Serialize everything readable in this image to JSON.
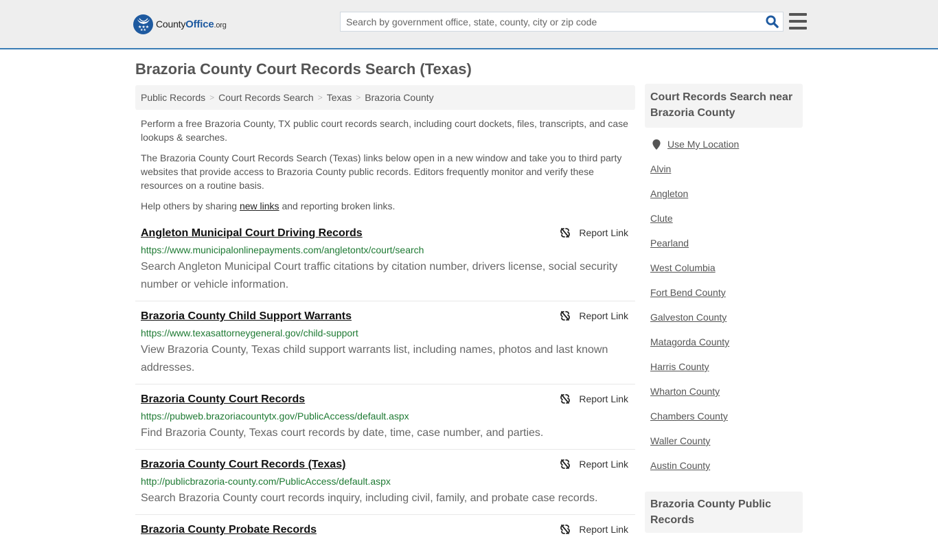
{
  "header": {
    "logo": {
      "name": "County",
      "brand": "Office",
      "suffix": ".org"
    },
    "search": {
      "placeholder": "Search by government office, state, county, city or zip code",
      "value": ""
    },
    "icons": {
      "search": "search-icon",
      "menu": "hamburger-menu-icon"
    }
  },
  "page": {
    "title": "Brazoria County Court Records Search (Texas)"
  },
  "breadcrumb": [
    {
      "label": "Public Records"
    },
    {
      "label": "Court Records Search"
    },
    {
      "label": "Texas"
    },
    {
      "label": "Brazoria County"
    }
  ],
  "breadcrumb_sep": ">",
  "intro": {
    "p1": "Perform a free Brazoria County, TX public court records search, including court dockets, files, transcripts, and case lookups & searches.",
    "p2": "The Brazoria County Court Records Search (Texas) links below open in a new window and take you to third party websites that provide access to Brazoria County public records. Editors frequently monitor and verify these resources on a routine basis.",
    "p3_before": "Help others by sharing ",
    "p3_link": "new links",
    "p3_after": " and reporting broken links."
  },
  "report_label": "Report Link",
  "results": [
    {
      "title": "Angleton Municipal Court Driving Records",
      "url": "https://www.municipalonlinepayments.com/angletontx/court/search",
      "description": "Search Angleton Municipal Court traffic citations by citation number, drivers license, social security number or vehicle information."
    },
    {
      "title": "Brazoria County Child Support Warrants",
      "url": "https://www.texasattorneygeneral.gov/child-support",
      "description": "View Brazoria County, Texas child support warrants list, including names, photos and last known addresses."
    },
    {
      "title": "Brazoria County Court Records",
      "url": "https://pubweb.brazoriacountytx.gov/PublicAccess/default.aspx",
      "description": "Find Brazoria County, Texas court records by date, time, case number, and parties."
    },
    {
      "title": "Brazoria County Court Records (Texas)",
      "url": "http://publicbrazoria-county.com/PublicAccess/default.aspx",
      "description": "Search Brazoria County court records inquiry, including civil, family, and probate case records."
    },
    {
      "title": "Brazoria County Probate Records",
      "url": "",
      "description": ""
    }
  ],
  "sidebar": {
    "heading": "Court Records Search near Brazoria County",
    "use_location": "Use My Location",
    "links": [
      "Alvin",
      "Angleton",
      "Clute",
      "Pearland",
      "West Columbia",
      "Fort Bend County",
      "Galveston County",
      "Matagorda County",
      "Harris County",
      "Wharton County",
      "Chambers County",
      "Waller County",
      "Austin County"
    ],
    "heading2": "Brazoria County Public Records"
  },
  "colors": {
    "brand_blue": "#1e5aa0",
    "header_border": "#3a7cb5",
    "url_green": "#1e7a33"
  }
}
